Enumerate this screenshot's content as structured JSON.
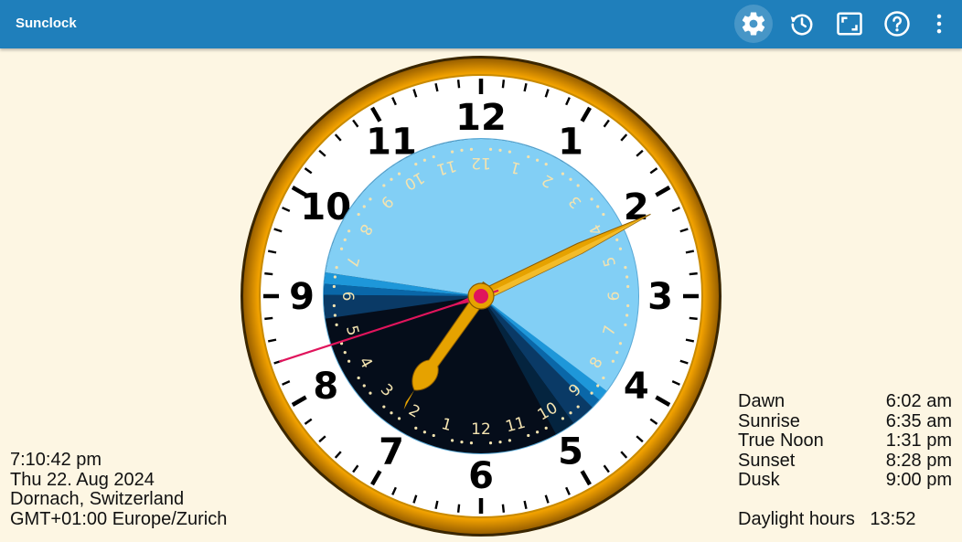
{
  "app": {
    "title": "Sunclock"
  },
  "toolbar": {
    "items": [
      {
        "icon": "gear-icon",
        "label": "Settings"
      },
      {
        "icon": "clock-reset-icon",
        "label": "Reset time"
      },
      {
        "icon": "fullscreen-icon",
        "label": "Full screen"
      },
      {
        "icon": "help-icon",
        "label": "Help"
      },
      {
        "icon": "more-vert-icon",
        "label": "More options"
      }
    ]
  },
  "clock": {
    "hour_numbers": [
      "12",
      "1",
      "2",
      "3",
      "4",
      "5",
      "6",
      "7",
      "8",
      "9",
      "10",
      "11"
    ],
    "inner_numbers_night": [
      "10",
      "11",
      "12",
      "1",
      "2",
      "3",
      "4",
      "5",
      "6"
    ],
    "inner_numbers_day": [
      "7",
      "8",
      "9",
      "10",
      "11",
      "12",
      "1",
      "2",
      "3",
      "4",
      "5",
      "6",
      "7",
      "8",
      "9"
    ],
    "time": {
      "hours": 19,
      "minutes": 10,
      "seconds": 42
    },
    "colors": {
      "rim": "#F2A100",
      "face": "#FFFFFF",
      "night": "#050D1A",
      "deep_twilight": "#0A3A66",
      "twilight": "#0A67A8",
      "dawn": "#1E97D9",
      "day": "#82CFF5",
      "hands": "#E6A200",
      "second_hand": "#E0145C"
    }
  },
  "location_info": {
    "time": "7:10:42 pm",
    "date": "Thu 22. Aug 2024",
    "place": "Dornach, Switzerland",
    "timezone": "GMT+01:00 Europe/Zurich"
  },
  "sun_times": [
    {
      "label": "Dawn",
      "value": "6:02 am"
    },
    {
      "label": "Sunrise",
      "value": "6:35 am"
    },
    {
      "label": "True Noon",
      "value": "1:31 pm"
    },
    {
      "label": "Sunset",
      "value": "8:28 pm"
    },
    {
      "label": "Dusk",
      "value": "9:00 pm"
    }
  ],
  "daylight": {
    "label": "Daylight hours",
    "value": "13:52"
  }
}
